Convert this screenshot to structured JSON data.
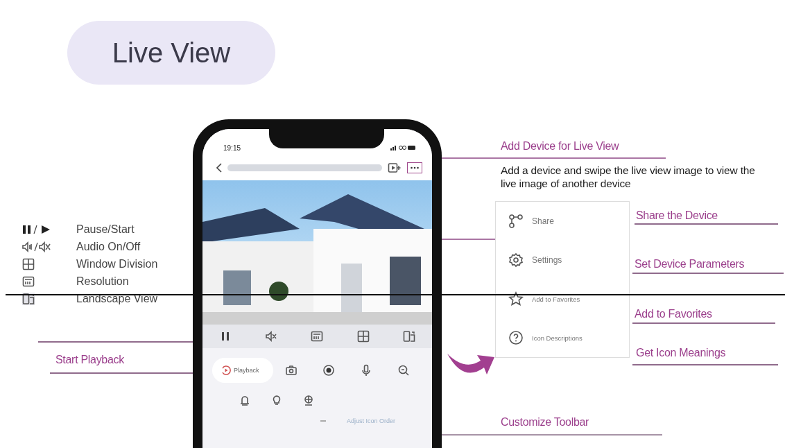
{
  "title": "Live View",
  "legend": [
    {
      "kind": "pause-start",
      "label": "Pause/Start"
    },
    {
      "kind": "audio",
      "label": "Audio On/Off"
    },
    {
      "kind": "window",
      "label": "Window Division"
    },
    {
      "kind": "resolution",
      "label": "Resolution"
    },
    {
      "kind": "landscape",
      "label": "Landscape View"
    }
  ],
  "phone": {
    "time": "19:15",
    "toolbar": [
      {
        "kind": "pause"
      },
      {
        "kind": "mute"
      },
      {
        "kind": "resolution"
      },
      {
        "kind": "window"
      },
      {
        "kind": "landscape"
      }
    ],
    "playback_button": "Playback",
    "controls": [
      {
        "kind": "camera"
      },
      {
        "kind": "record"
      },
      {
        "kind": "mic"
      },
      {
        "kind": "zoom"
      },
      {
        "kind": "alarm"
      },
      {
        "kind": "light"
      },
      {
        "kind": "face"
      }
    ],
    "adjust_link": "Adjust Icon Order"
  },
  "menu": [
    {
      "kind": "share",
      "label": "Share"
    },
    {
      "kind": "settings",
      "label": "Settings"
    },
    {
      "kind": "star",
      "label": "Add to Favorites"
    },
    {
      "kind": "help",
      "label": "Icon Descriptions"
    }
  ],
  "callouts": [
    {
      "label": "Add Device for Live View"
    },
    {
      "label": "Share the Device"
    },
    {
      "label": "Set Device Parameters"
    },
    {
      "label": "Add to Favorites"
    },
    {
      "label": "Get Icon Meanings"
    },
    {
      "label": "Customize Toolbar"
    },
    {
      "label": "Start Playback"
    }
  ],
  "description": "Add a device and swipe the live view image to view the live image of another device"
}
